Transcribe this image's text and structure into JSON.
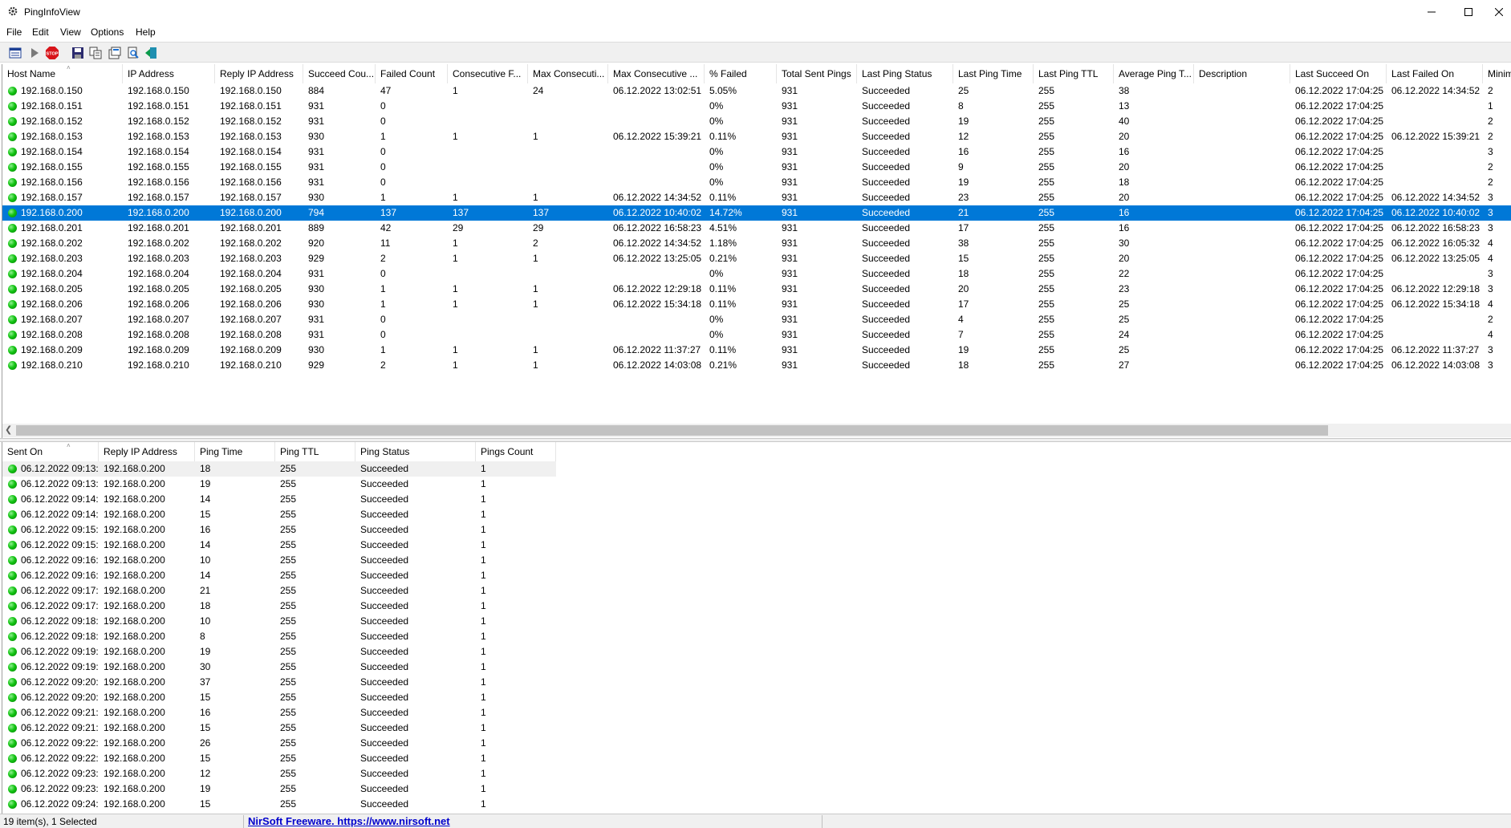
{
  "app": {
    "title": "PingInfoView"
  },
  "menu": [
    "File",
    "Edit",
    "View",
    "Options",
    "Help"
  ],
  "toolbar": [
    "options-icon",
    "start-icon",
    "stop-icon",
    "save-icon",
    "copy-icon",
    "properties-icon",
    "find-icon",
    "exit-icon"
  ],
  "top_table": {
    "columns": [
      "Host Name",
      "IP Address",
      "Reply IP Address",
      "Succeed Cou...",
      "Failed Count",
      "Consecutive F...",
      "Max Consecuti...",
      "Max Consecutive ...",
      "% Failed",
      "Total Sent Pings",
      "Last Ping Status",
      "Last Ping Time",
      "Last Ping TTL",
      "Average Ping T...",
      "Description",
      "Last Succeed On",
      "Last Failed On",
      "Minim"
    ],
    "selected_index": 8,
    "rows": [
      [
        "192.168.0.150",
        "192.168.0.150",
        "192.168.0.150",
        "884",
        "47",
        "1",
        "24",
        "06.12.2022 13:02:51",
        "5.05%",
        "931",
        "Succeeded",
        "25",
        "255",
        "38",
        "",
        "06.12.2022 17:04:25",
        "06.12.2022 14:34:52",
        "2"
      ],
      [
        "192.168.0.151",
        "192.168.0.151",
        "192.168.0.151",
        "931",
        "0",
        "",
        "",
        "",
        "0%",
        "931",
        "Succeeded",
        "8",
        "255",
        "13",
        "",
        "06.12.2022 17:04:25",
        "",
        "1"
      ],
      [
        "192.168.0.152",
        "192.168.0.152",
        "192.168.0.152",
        "931",
        "0",
        "",
        "",
        "",
        "0%",
        "931",
        "Succeeded",
        "19",
        "255",
        "40",
        "",
        "06.12.2022 17:04:25",
        "",
        "2"
      ],
      [
        "192.168.0.153",
        "192.168.0.153",
        "192.168.0.153",
        "930",
        "1",
        "1",
        "1",
        "06.12.2022 15:39:21",
        "0.11%",
        "931",
        "Succeeded",
        "12",
        "255",
        "20",
        "",
        "06.12.2022 17:04:25",
        "06.12.2022 15:39:21",
        "2"
      ],
      [
        "192.168.0.154",
        "192.168.0.154",
        "192.168.0.154",
        "931",
        "0",
        "",
        "",
        "",
        "0%",
        "931",
        "Succeeded",
        "16",
        "255",
        "16",
        "",
        "06.12.2022 17:04:25",
        "",
        "3"
      ],
      [
        "192.168.0.155",
        "192.168.0.155",
        "192.168.0.155",
        "931",
        "0",
        "",
        "",
        "",
        "0%",
        "931",
        "Succeeded",
        "9",
        "255",
        "20",
        "",
        "06.12.2022 17:04:25",
        "",
        "2"
      ],
      [
        "192.168.0.156",
        "192.168.0.156",
        "192.168.0.156",
        "931",
        "0",
        "",
        "",
        "",
        "0%",
        "931",
        "Succeeded",
        "19",
        "255",
        "18",
        "",
        "06.12.2022 17:04:25",
        "",
        "2"
      ],
      [
        "192.168.0.157",
        "192.168.0.157",
        "192.168.0.157",
        "930",
        "1",
        "1",
        "1",
        "06.12.2022 14:34:52",
        "0.11%",
        "931",
        "Succeeded",
        "23",
        "255",
        "20",
        "",
        "06.12.2022 17:04:25",
        "06.12.2022 14:34:52",
        "3"
      ],
      [
        "192.168.0.200",
        "192.168.0.200",
        "192.168.0.200",
        "794",
        "137",
        "137",
        "137",
        "06.12.2022 10:40:02",
        "14.72%",
        "931",
        "Succeeded",
        "21",
        "255",
        "16",
        "",
        "06.12.2022 17:04:25",
        "06.12.2022 10:40:02",
        "3"
      ],
      [
        "192.168.0.201",
        "192.168.0.201",
        "192.168.0.201",
        "889",
        "42",
        "29",
        "29",
        "06.12.2022 16:58:23",
        "4.51%",
        "931",
        "Succeeded",
        "17",
        "255",
        "16",
        "",
        "06.12.2022 17:04:25",
        "06.12.2022 16:58:23",
        "3"
      ],
      [
        "192.168.0.202",
        "192.168.0.202",
        "192.168.0.202",
        "920",
        "11",
        "1",
        "2",
        "06.12.2022 14:34:52",
        "1.18%",
        "931",
        "Succeeded",
        "38",
        "255",
        "30",
        "",
        "06.12.2022 17:04:25",
        "06.12.2022 16:05:32",
        "4"
      ],
      [
        "192.168.0.203",
        "192.168.0.203",
        "192.168.0.203",
        "929",
        "2",
        "1",
        "1",
        "06.12.2022 13:25:05",
        "0.21%",
        "931",
        "Succeeded",
        "15",
        "255",
        "20",
        "",
        "06.12.2022 17:04:25",
        "06.12.2022 13:25:05",
        "4"
      ],
      [
        "192.168.0.204",
        "192.168.0.204",
        "192.168.0.204",
        "931",
        "0",
        "",
        "",
        "",
        "0%",
        "931",
        "Succeeded",
        "18",
        "255",
        "22",
        "",
        "06.12.2022 17:04:25",
        "",
        "3"
      ],
      [
        "192.168.0.205",
        "192.168.0.205",
        "192.168.0.205",
        "930",
        "1",
        "1",
        "1",
        "06.12.2022 12:29:18",
        "0.11%",
        "931",
        "Succeeded",
        "20",
        "255",
        "23",
        "",
        "06.12.2022 17:04:25",
        "06.12.2022 12:29:18",
        "3"
      ],
      [
        "192.168.0.206",
        "192.168.0.206",
        "192.168.0.206",
        "930",
        "1",
        "1",
        "1",
        "06.12.2022 15:34:18",
        "0.11%",
        "931",
        "Succeeded",
        "17",
        "255",
        "25",
        "",
        "06.12.2022 17:04:25",
        "06.12.2022 15:34:18",
        "4"
      ],
      [
        "192.168.0.207",
        "192.168.0.207",
        "192.168.0.207",
        "931",
        "0",
        "",
        "",
        "",
        "0%",
        "931",
        "Succeeded",
        "4",
        "255",
        "25",
        "",
        "06.12.2022 17:04:25",
        "",
        "2"
      ],
      [
        "192.168.0.208",
        "192.168.0.208",
        "192.168.0.208",
        "931",
        "0",
        "",
        "",
        "",
        "0%",
        "931",
        "Succeeded",
        "7",
        "255",
        "24",
        "",
        "06.12.2022 17:04:25",
        "",
        "4"
      ],
      [
        "192.168.0.209",
        "192.168.0.209",
        "192.168.0.209",
        "930",
        "1",
        "1",
        "1",
        "06.12.2022 11:37:27",
        "0.11%",
        "931",
        "Succeeded",
        "19",
        "255",
        "25",
        "",
        "06.12.2022 17:04:25",
        "06.12.2022 11:37:27",
        "3"
      ],
      [
        "192.168.0.210",
        "192.168.0.210",
        "192.168.0.210",
        "929",
        "2",
        "1",
        "1",
        "06.12.2022 14:03:08",
        "0.21%",
        "931",
        "Succeeded",
        "18",
        "255",
        "27",
        "",
        "06.12.2022 17:04:25",
        "06.12.2022 14:03:08",
        "3"
      ]
    ]
  },
  "bottom_table": {
    "columns": [
      "Sent On",
      "Reply IP Address",
      "Ping Time",
      "Ping TTL",
      "Ping Status",
      "Pings Count"
    ],
    "highlight_index": 0,
    "rows": [
      [
        "06.12.2022 09:13:...",
        "192.168.0.200",
        "18",
        "255",
        "Succeeded",
        "1"
      ],
      [
        "06.12.2022 09:13:...",
        "192.168.0.200",
        "19",
        "255",
        "Succeeded",
        "1"
      ],
      [
        "06.12.2022 09:14:...",
        "192.168.0.200",
        "14",
        "255",
        "Succeeded",
        "1"
      ],
      [
        "06.12.2022 09:14:...",
        "192.168.0.200",
        "15",
        "255",
        "Succeeded",
        "1"
      ],
      [
        "06.12.2022 09:15:...",
        "192.168.0.200",
        "16",
        "255",
        "Succeeded",
        "1"
      ],
      [
        "06.12.2022 09:15:...",
        "192.168.0.200",
        "14",
        "255",
        "Succeeded",
        "1"
      ],
      [
        "06.12.2022 09:16:...",
        "192.168.0.200",
        "10",
        "255",
        "Succeeded",
        "1"
      ],
      [
        "06.12.2022 09:16:...",
        "192.168.0.200",
        "14",
        "255",
        "Succeeded",
        "1"
      ],
      [
        "06.12.2022 09:17:...",
        "192.168.0.200",
        "21",
        "255",
        "Succeeded",
        "1"
      ],
      [
        "06.12.2022 09:17:...",
        "192.168.0.200",
        "18",
        "255",
        "Succeeded",
        "1"
      ],
      [
        "06.12.2022 09:18:...",
        "192.168.0.200",
        "10",
        "255",
        "Succeeded",
        "1"
      ],
      [
        "06.12.2022 09:18:...",
        "192.168.0.200",
        "8",
        "255",
        "Succeeded",
        "1"
      ],
      [
        "06.12.2022 09:19:...",
        "192.168.0.200",
        "19",
        "255",
        "Succeeded",
        "1"
      ],
      [
        "06.12.2022 09:19:...",
        "192.168.0.200",
        "30",
        "255",
        "Succeeded",
        "1"
      ],
      [
        "06.12.2022 09:20:...",
        "192.168.0.200",
        "37",
        "255",
        "Succeeded",
        "1"
      ],
      [
        "06.12.2022 09:20:...",
        "192.168.0.200",
        "15",
        "255",
        "Succeeded",
        "1"
      ],
      [
        "06.12.2022 09:21:...",
        "192.168.0.200",
        "16",
        "255",
        "Succeeded",
        "1"
      ],
      [
        "06.12.2022 09:21:...",
        "192.168.0.200",
        "15",
        "255",
        "Succeeded",
        "1"
      ],
      [
        "06.12.2022 09:22:...",
        "192.168.0.200",
        "26",
        "255",
        "Succeeded",
        "1"
      ],
      [
        "06.12.2022 09:22:...",
        "192.168.0.200",
        "15",
        "255",
        "Succeeded",
        "1"
      ],
      [
        "06.12.2022 09:23:...",
        "192.168.0.200",
        "12",
        "255",
        "Succeeded",
        "1"
      ],
      [
        "06.12.2022 09:23:...",
        "192.168.0.200",
        "19",
        "255",
        "Succeeded",
        "1"
      ],
      [
        "06.12.2022 09:24:...",
        "192.168.0.200",
        "15",
        "255",
        "Succeeded",
        "1"
      ]
    ]
  },
  "status": {
    "items": "19 item(s), 1 Selected",
    "link": "NirSoft Freeware. https://www.nirsoft.net"
  },
  "colors": {
    "selection": "#0078d7",
    "status_ok": "#12c412",
    "link": "#0000cc"
  }
}
